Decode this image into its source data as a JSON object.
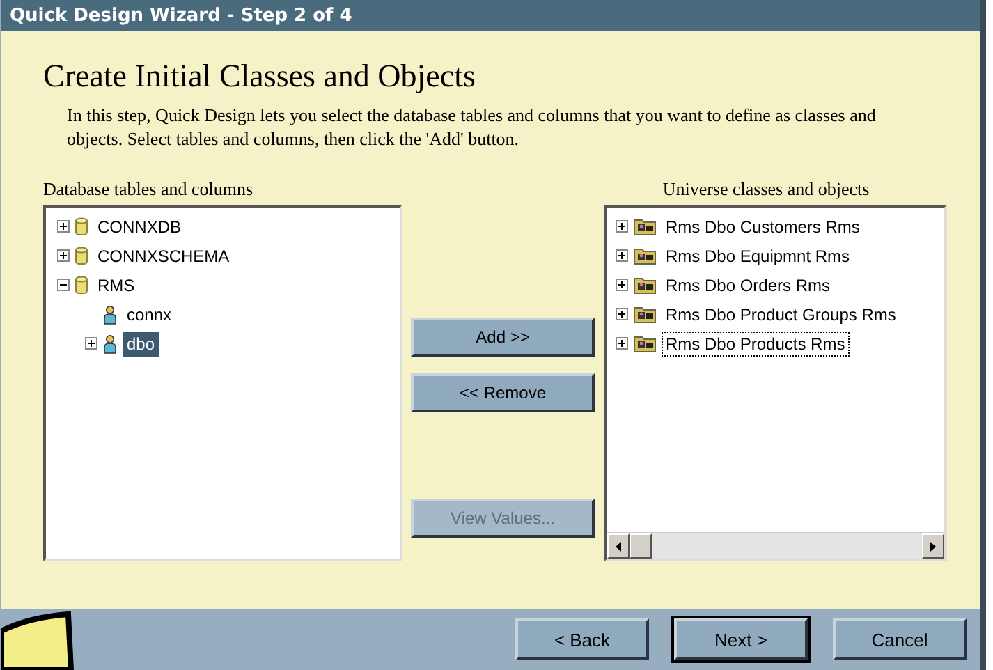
{
  "window": {
    "title": "Quick Design Wizard - Step 2 of 4"
  },
  "heading": "Create Initial Classes and Objects",
  "description": "In this step, Quick Design lets you select the database tables and columns that you want to define as classes and objects. Select tables and columns, then click the 'Add' button.",
  "left_panel": {
    "label": "Database tables and columns",
    "items": [
      {
        "kind": "database",
        "label": "CONNXDB",
        "expanded": false,
        "selected": false
      },
      {
        "kind": "database",
        "label": "CONNXSCHEMA",
        "expanded": false,
        "selected": false
      },
      {
        "kind": "database",
        "label": "RMS",
        "expanded": true,
        "selected": false,
        "children": [
          {
            "kind": "user",
            "label": "connx",
            "expandable": false,
            "selected": false
          },
          {
            "kind": "user",
            "label": "dbo",
            "expandable": true,
            "selected": true
          }
        ]
      }
    ]
  },
  "middle_buttons": [
    {
      "label": "Add >>",
      "disabled": false
    },
    {
      "label": "<< Remove",
      "disabled": false
    }
  ],
  "view_values_button": {
    "label": "View Values...",
    "disabled": true
  },
  "right_panel": {
    "label": "Universe classes and objects",
    "items": [
      {
        "label": "Rms Dbo Customers Rms",
        "focused": false
      },
      {
        "label": "Rms Dbo Equipmnt Rms",
        "focused": false
      },
      {
        "label": "Rms Dbo Orders Rms",
        "focused": false
      },
      {
        "label": "Rms Dbo Product Groups Rms",
        "focused": false
      },
      {
        "label": "Rms Dbo Products Rms",
        "focused": true
      }
    ]
  },
  "footer_buttons": [
    {
      "label": "< Back",
      "default": false
    },
    {
      "label": "Next >",
      "default": true
    },
    {
      "label": "Cancel",
      "default": false
    }
  ]
}
